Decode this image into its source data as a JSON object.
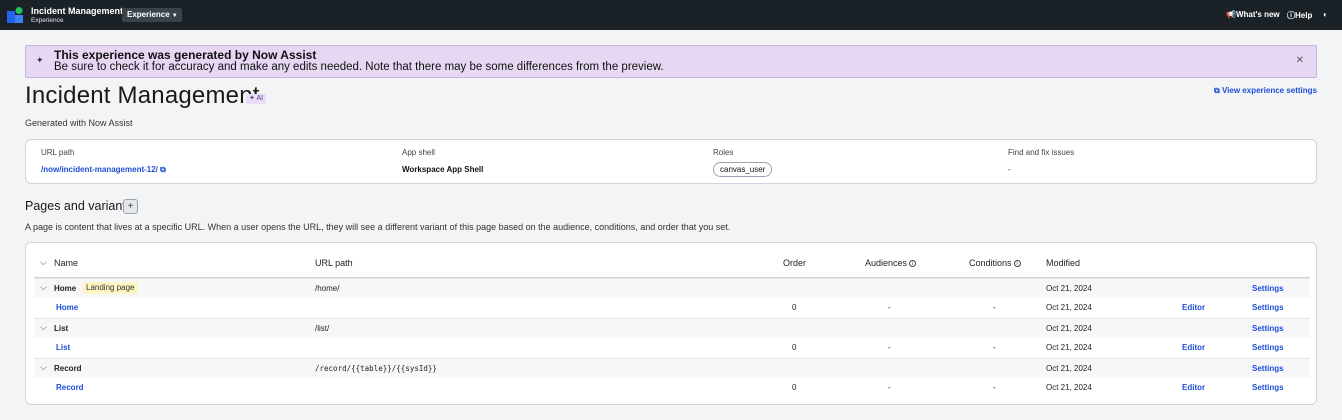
{
  "topbar": {
    "app_title": "Incident Management",
    "app_subtitle": "Experience",
    "experience_menu": "Experience",
    "whats_new": "What's new",
    "help": "Help",
    "colors": {
      "background": "#1b2227",
      "menu_button": "#3a4349"
    }
  },
  "banner": {
    "title": "This experience was generated by Now Assist",
    "text": "Be sure to check it for accuracy and make any edits needed. Note that there may be some differences from the preview.",
    "background": "#e6d8f3"
  },
  "page": {
    "title": "Incident Management",
    "ai_badge": "AI",
    "view_settings": "View experience settings",
    "generated": "Generated with Now Assist"
  },
  "info": {
    "url_path_label": "URL path",
    "url_path_value": "/now/incident-management-12/",
    "app_shell_label": "App shell",
    "app_shell_value": "Workspace App Shell",
    "roles_label": "Roles",
    "roles_value": "canvas_user",
    "find_label": "Find and fix issues",
    "find_value": "-"
  },
  "pages": {
    "title": "Pages and variants",
    "add_label": "+",
    "description": "A page is content that lives at a specific URL. When a user opens the URL, they will see a different variant of this page based on the audience, conditions, and order that you set.",
    "columns": {
      "name": "Name",
      "url_path": "URL path",
      "order": "Order",
      "audiences": "Audiences",
      "conditions": "Conditions",
      "modified": "Modified"
    },
    "rows": [
      {
        "name": "Home",
        "badge": "Landing page",
        "path": "/home/",
        "modified": "Oct 21, 2024",
        "settings": "Settings",
        "variant": {
          "name": "Home",
          "order": "0",
          "audiences": "-",
          "conditions": "-",
          "modified": "Oct 21, 2024",
          "editor": "Editor",
          "settings": "Settings"
        }
      },
      {
        "name": "List",
        "path": "/list/",
        "modified": "Oct 21, 2024",
        "settings": "Settings",
        "variant": {
          "name": "List",
          "order": "0",
          "audiences": "-",
          "conditions": "-",
          "modified": "Oct 21, 2024",
          "editor": "Editor",
          "settings": "Settings"
        }
      },
      {
        "name": "Record",
        "path": "/record/{{table}}/{{sysId}}",
        "modified": "Oct 21, 2024",
        "settings": "Settings",
        "variant": {
          "name": "Record",
          "order": "0",
          "audiences": "-",
          "conditions": "-",
          "modified": "Oct 21, 2024",
          "editor": "Editor",
          "settings": "Settings"
        }
      }
    ]
  },
  "link_color": "#1d4ed8"
}
